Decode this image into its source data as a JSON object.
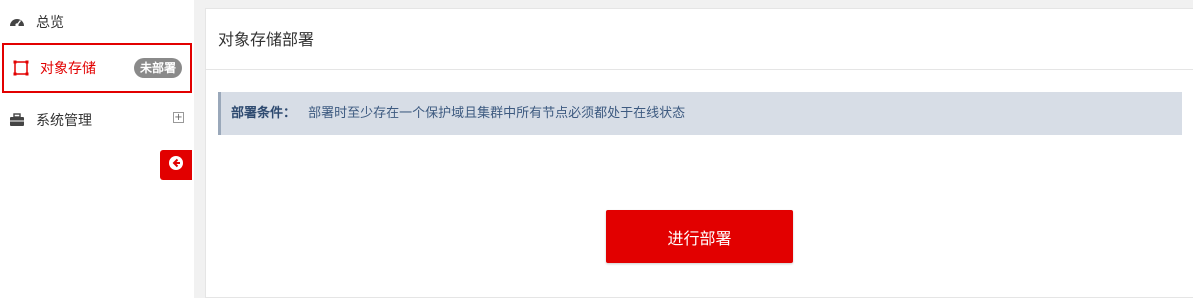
{
  "sidebar": {
    "items": [
      {
        "label": "总览",
        "icon": "dashboard-icon"
      },
      {
        "label": "对象存储",
        "icon": "object-storage-icon",
        "badge": "未部署"
      },
      {
        "label": "系统管理",
        "icon": "briefcase-icon",
        "expand": "+"
      }
    ],
    "collapse_icon": "arrow-left-icon"
  },
  "main": {
    "title": "对象存储部署",
    "alert": {
      "label": "部署条件：",
      "text": "部署时至少存在一个保护域且集群中所有节点必须都处于在线状态"
    },
    "deploy_button": "进行部署"
  },
  "colors": {
    "accent": "#e20000",
    "alert_bg": "#d7dde6"
  }
}
